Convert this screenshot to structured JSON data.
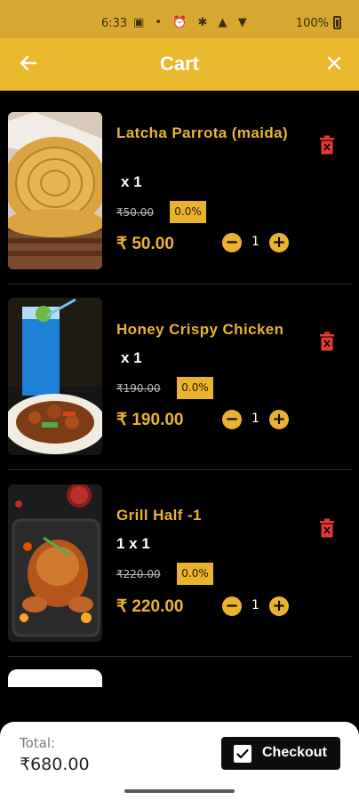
{
  "status_bar": {
    "time": "6:33",
    "battery": "100%"
  },
  "app_bar": {
    "title": "Cart",
    "back_icon": "arrow-left-icon",
    "close_icon": "close-icon"
  },
  "cart_items": [
    {
      "name": "Latcha Parrota (maida)",
      "quantity": "x 1",
      "original_price": "₹50.00",
      "discount": "0.0%",
      "price": "₹ 50.00",
      "count": "1",
      "image": "latcha-parrota-photo"
    },
    {
      "name": "Honey Crispy Chicken",
      "quantity": "x 1",
      "original_price": "₹190.00",
      "discount": "0.0%",
      "price": "₹ 190.00",
      "count": "1",
      "image": "honey-crispy-chicken-photo"
    },
    {
      "name": "Grill Half -1",
      "quantity": "1 x 1",
      "original_price": "₹220.00",
      "discount": "0.0%",
      "price": "₹ 220.00",
      "count": "1",
      "image": "grill-chicken-photo"
    }
  ],
  "footer": {
    "total_label": "Total:",
    "total_value": "₹680.00",
    "checkout_label": "Checkout"
  },
  "colors": {
    "accent": "#e9b32d",
    "appbar": "#eab92e",
    "statusbar": "#d6a82f",
    "background": "#000000",
    "delete": "#e53935"
  }
}
